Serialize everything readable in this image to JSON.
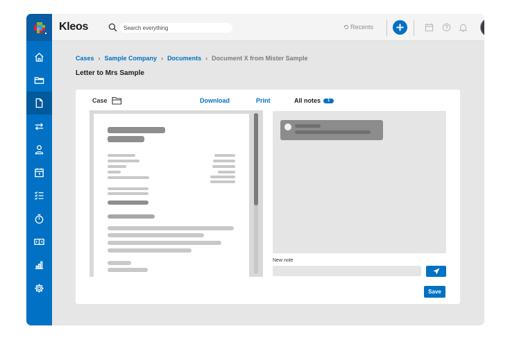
{
  "app": {
    "brand": "Kleos",
    "accent_color": "#0071c4"
  },
  "header": {
    "search_placeholder": "Search everything",
    "recents_label": "Recents",
    "icons": [
      "search-icon",
      "history-icon",
      "plus-icon",
      "calendar-icon",
      "help-icon",
      "bell-icon",
      "avatar"
    ]
  },
  "sidebar": {
    "items": [
      {
        "name": "home",
        "icon": "home-icon"
      },
      {
        "name": "folders",
        "icon": "folder-icon"
      },
      {
        "name": "documents",
        "icon": "document-icon",
        "active": true
      },
      {
        "name": "transfers",
        "icon": "transfer-icon"
      },
      {
        "name": "contacts",
        "icon": "person-icon"
      },
      {
        "name": "calendar",
        "icon": "calendar-icon"
      },
      {
        "name": "tasks",
        "icon": "checklist-icon"
      },
      {
        "name": "timer",
        "icon": "stopwatch-icon"
      },
      {
        "name": "billing",
        "icon": "money-icon"
      },
      {
        "name": "reports",
        "icon": "bar-chart-icon"
      },
      {
        "name": "settings",
        "icon": "gear-icon"
      }
    ]
  },
  "breadcrumb": {
    "items": [
      "Cases",
      "Sample Company",
      "Documents"
    ],
    "current": "Document X from Mister Sample"
  },
  "page": {
    "title": "Letter to Mrs Sample"
  },
  "toolbar": {
    "case_label": "Case",
    "download_label": "Download",
    "print_label": "Print",
    "all_notes_label": "All notes",
    "notes_count": "1"
  },
  "notes": {
    "new_note_label": "New note",
    "save_label": "Save"
  }
}
